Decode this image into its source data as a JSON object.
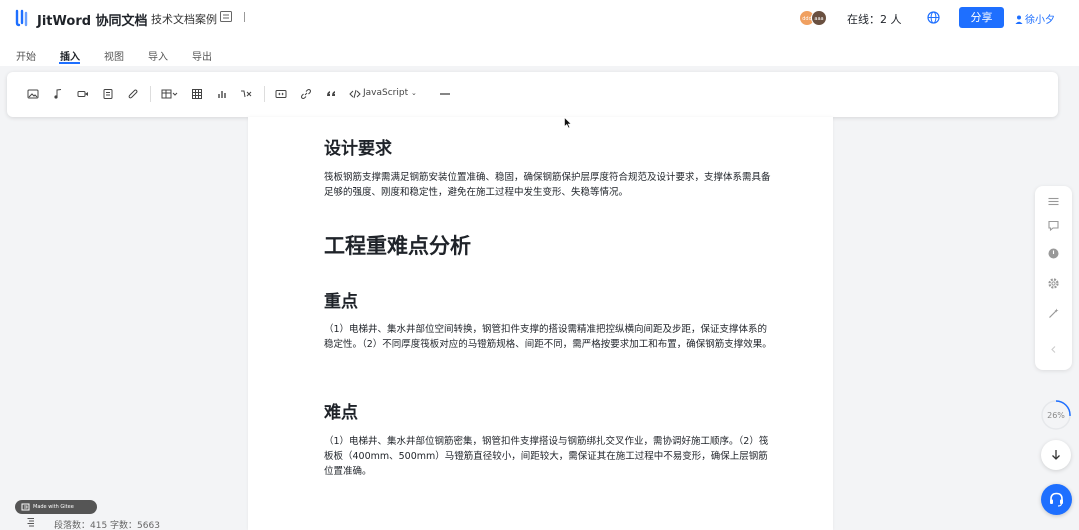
{
  "header": {
    "app_name": "JitWord 协同文档",
    "doc_title": "技术文档案例",
    "avatars": [
      "ddd",
      "aaa"
    ],
    "online_label": "在线：2 人",
    "share_label": "分享",
    "user_name": "徐小夕"
  },
  "tabs": [
    {
      "label": "开始",
      "active": false
    },
    {
      "label": "插入",
      "active": true
    },
    {
      "label": "视图",
      "active": false
    },
    {
      "label": "导入",
      "active": false
    },
    {
      "label": "导出",
      "active": false
    }
  ],
  "toolbar": {
    "code_language": "JavaScript",
    "icons": [
      "image-icon",
      "audio-icon",
      "video-icon",
      "file-icon",
      "attachment-icon",
      "table-insert-icon",
      "grid-icon",
      "chart-icon",
      "formula-icon",
      "embed-icon",
      "link-icon",
      "quote-icon",
      "code-icon",
      "divider-icon"
    ]
  },
  "document": {
    "sections": [
      {
        "type": "h2",
        "text": "设计要求"
      },
      {
        "type": "p",
        "text": "筏板钢筋支撑需满足钢筋安装位置准确、稳固，确保钢筋保护层厚度符合规范及设计要求，支撑体系需具备足够的强度、刚度和稳定性，避免在施工过程中发生变形、失稳等情况。"
      },
      {
        "type": "h1",
        "text": "工程重难点分析"
      },
      {
        "type": "h2",
        "text": "重点"
      },
      {
        "type": "p",
        "text": "（1）电梯井、集水井部位空间转换，钢管扣件支撑的搭设需精准把控纵横向间距及步距，保证支撑体系的稳定性。（2）不同厚度筏板对应的马镫筋规格、间距不同，需严格按要求加工和布置，确保钢筋支撑效果。"
      },
      {
        "type": "h2",
        "text": "难点"
      },
      {
        "type": "p",
        "text": "（1）电梯井、集水井部位钢筋密集，钢管扣件支撑搭设与钢筋绑扎交叉作业，需协调好施工顺序。（2）筏板板（400mm、500mm）马镫筋直径较小，间距较大，需保证其在施工过程中不易变形，确保上层钢筋位置准确。"
      }
    ]
  },
  "right_rail": {
    "icons": [
      "menu-icon",
      "comment-icon",
      "history-icon",
      "settings-icon",
      "magic-icon",
      "collapse-icon"
    ],
    "progress_percent": 26,
    "progress_label": "26%"
  },
  "badge_label": "Made with Gitee",
  "status": {
    "text": "段落数：415  字数：5663"
  },
  "colors": {
    "accent": "#1e6fff",
    "page_bg": "#f3f4f6"
  }
}
